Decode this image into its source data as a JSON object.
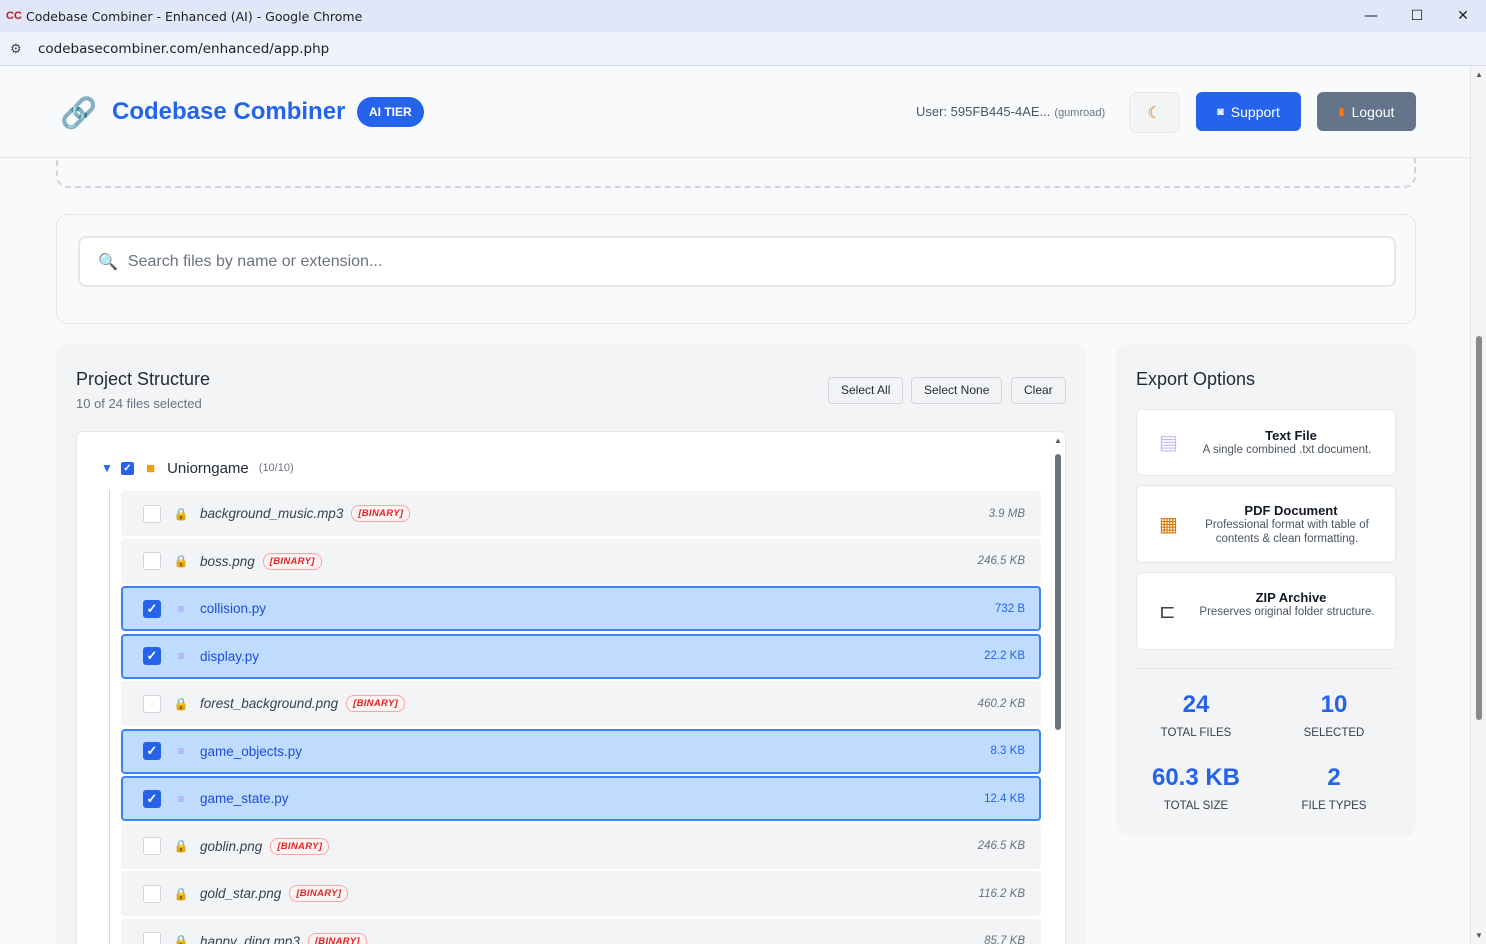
{
  "window": {
    "title": "Codebase Combiner - Enhanced (AI) - Google Chrome",
    "favicon": "CC",
    "minimize": "—",
    "maximize": "☐",
    "close": "✕"
  },
  "browser": {
    "url": "codebasecombiner.com/enhanced/app.php"
  },
  "header": {
    "brand": "Codebase Combiner",
    "tier": "AI TIER",
    "user_label": "User: 595FB445-4AE...",
    "user_source": "(gumroad)",
    "theme_icon": "moon-icon",
    "support_label": "Support",
    "logout_label": "Logout"
  },
  "search": {
    "placeholder": "Search files by name or extension..."
  },
  "project": {
    "title": "Project Structure",
    "subtitle": "10 of 24 files selected",
    "select_all": "Select All",
    "select_none": "Select None",
    "clear": "Clear",
    "folder": {
      "name": "Uniorngame",
      "count": "(10/10)",
      "checked": true
    },
    "files": [
      {
        "name": "background_music.mp3",
        "size": "3.9 MB",
        "binary": true,
        "selected": false
      },
      {
        "name": "boss.png",
        "size": "246.5 KB",
        "binary": true,
        "selected": false
      },
      {
        "name": "collision.py",
        "size": "732 B",
        "binary": false,
        "selected": true
      },
      {
        "name": "display.py",
        "size": "22.2 KB",
        "binary": false,
        "selected": true
      },
      {
        "name": "forest_background.png",
        "size": "460.2 KB",
        "binary": true,
        "selected": false
      },
      {
        "name": "game_objects.py",
        "size": "8.3 KB",
        "binary": false,
        "selected": true
      },
      {
        "name": "game_state.py",
        "size": "12.4 KB",
        "binary": false,
        "selected": true
      },
      {
        "name": "goblin.png",
        "size": "246.5 KB",
        "binary": true,
        "selected": false
      },
      {
        "name": "gold_star.png",
        "size": "116.2 KB",
        "binary": true,
        "selected": false
      },
      {
        "name": "happy_ding.mp3",
        "size": "85.7 KB",
        "binary": true,
        "selected": false
      }
    ],
    "binary_badge": "[BINARY]"
  },
  "export": {
    "title": "Export Options",
    "options": [
      {
        "name": "Text File",
        "desc": "A single combined .txt document.",
        "icon": "text-file-icon"
      },
      {
        "name": "PDF Document",
        "desc": "Professional format with table of contents & clean formatting.",
        "icon": "clipboard-icon"
      },
      {
        "name": "ZIP Archive",
        "desc": "Preserves original folder structure.",
        "icon": "clamp-icon"
      }
    ],
    "stats": [
      {
        "value": "24",
        "label": "TOTAL FILES"
      },
      {
        "value": "10",
        "label": "SELECTED"
      },
      {
        "value": "60.3 KB",
        "label": "TOTAL SIZE"
      },
      {
        "value": "2",
        "label": "FILE TYPES"
      }
    ]
  }
}
